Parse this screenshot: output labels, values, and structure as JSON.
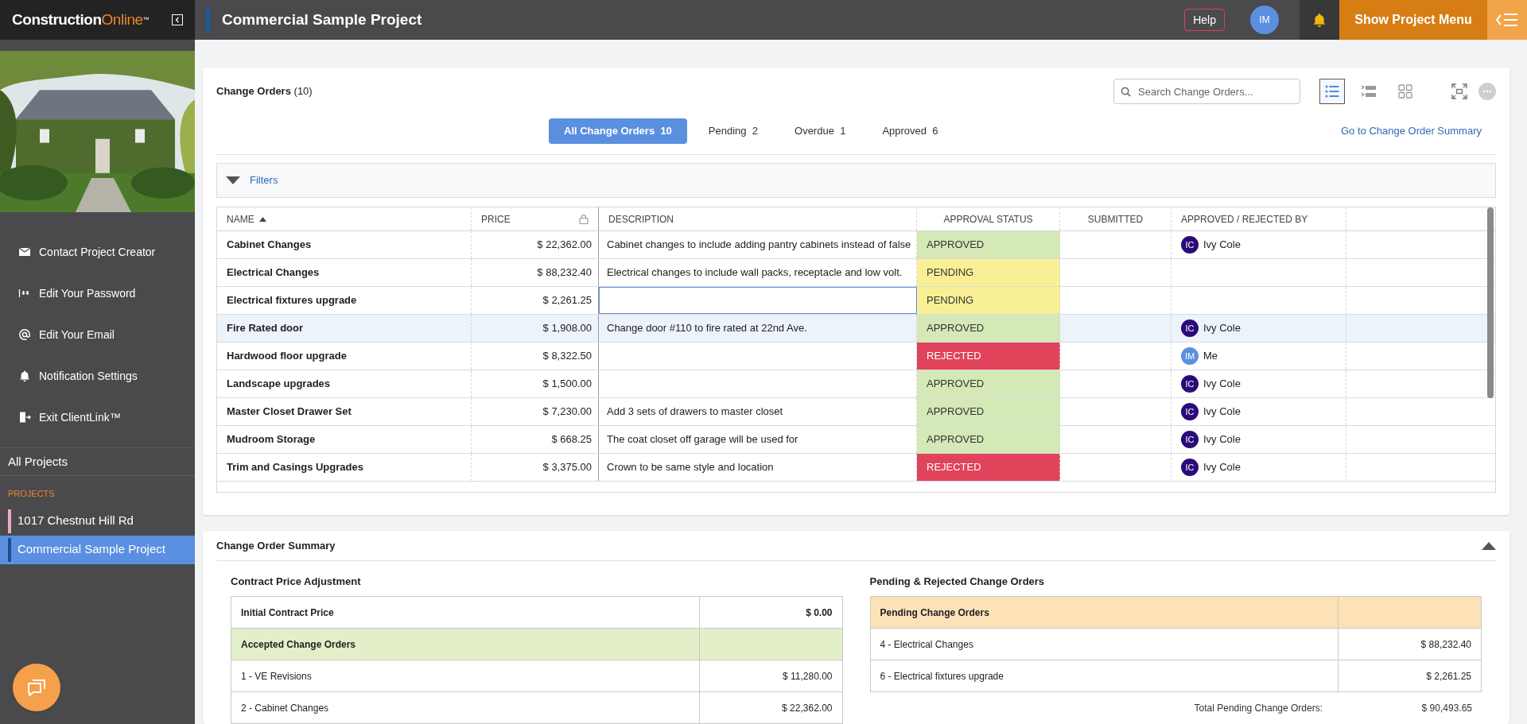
{
  "brand": {
    "name": "Construction",
    "accent": "Online",
    "mark": "™"
  },
  "header": {
    "project_title": "Commercial Sample Project",
    "help": "Help",
    "user_initials": "IM",
    "menu_button": "Show Project Menu"
  },
  "sidebar": {
    "items": [
      {
        "kind": "mail",
        "label": "Contact Project Creator"
      },
      {
        "kind": "password",
        "label": "Edit Your Password"
      },
      {
        "kind": "at",
        "label": "Edit Your Email"
      },
      {
        "kind": "bell",
        "label": "Notification Settings"
      },
      {
        "kind": "exit",
        "label": "Exit ClientLink™"
      }
    ],
    "all_projects": "All Projects",
    "projects_heading": "PROJECTS",
    "projects": [
      {
        "name": "1017 Chestnut Hill Rd",
        "color": "#f4a7c8",
        "selected": false
      },
      {
        "name": "Commercial Sample Project",
        "color": "#1d4f8c",
        "selected": true
      }
    ]
  },
  "change_orders": {
    "title": "Change Orders",
    "count": "(10)",
    "search": {
      "placeholder": "Search Change Orders..."
    },
    "view_modes": [
      {
        "kind": "list",
        "selected": true
      },
      {
        "kind": "detail",
        "selected": false
      },
      {
        "kind": "grid",
        "selected": false
      }
    ],
    "tabs": [
      {
        "label": "All Change Orders",
        "count": "10",
        "selected": true
      },
      {
        "label": "Pending",
        "count": "2",
        "selected": false
      },
      {
        "label": "Overdue",
        "count": "1",
        "selected": false
      },
      {
        "label": "Approved",
        "count": "6",
        "selected": false
      }
    ],
    "summary_link": "Go to Change Order Summary",
    "filters": "Filters",
    "table": {
      "columns": [
        "NAME",
        "PRICE",
        "DESCRIPTION",
        "APPROVAL STATUS",
        "SUBMITTED",
        "APPROVED / REJECTED BY"
      ],
      "rows": [
        {
          "name": "Cabinet Changes",
          "price": "$ 22,362.00",
          "description": "Cabinet changes to include adding pantry cabinets instead of false",
          "status": {
            "kind": "approved",
            "label": "APPROVED"
          },
          "approver": {
            "initials": "IC",
            "name": "Ivy Cole",
            "color": "#2b0a78"
          },
          "hovered": false,
          "focused": false
        },
        {
          "name": "Electrical Changes",
          "price": "$ 88,232.40",
          "description": "Electrical changes to include wall packs, receptacle and low volt.",
          "status": {
            "kind": "pending",
            "label": "PENDING"
          },
          "hovered": false,
          "focused": false
        },
        {
          "name": "Electrical fixtures upgrade",
          "price": "$ 2,261.25",
          "status": {
            "kind": "pending",
            "label": "PENDING"
          },
          "hovered": false,
          "focused": true
        },
        {
          "name": "Fire Rated door",
          "price": "$ 1,908.00",
          "description": "Change door #110 to fire rated at 22nd Ave.",
          "status": {
            "kind": "approved",
            "label": "APPROVED"
          },
          "approver": {
            "initials": "IC",
            "name": "Ivy Cole",
            "color": "#2b0a78"
          },
          "hovered": true,
          "focused": false
        },
        {
          "name": "Hardwood floor upgrade",
          "price": "$ 8,322.50",
          "status": {
            "kind": "rejected",
            "label": "REJECTED"
          },
          "approver": {
            "initials": "IM",
            "name": "Me",
            "color": "#5b8fe0"
          },
          "hovered": false,
          "focused": false
        },
        {
          "name": "Landscape upgrades",
          "price": "$ 1,500.00",
          "status": {
            "kind": "approved",
            "label": "APPROVED"
          },
          "approver": {
            "initials": "IC",
            "name": "Ivy Cole",
            "color": "#2b0a78"
          },
          "hovered": false,
          "focused": false
        },
        {
          "name": "Master Closet Drawer Set",
          "price": "$ 7,230.00",
          "description": "Add 3 sets of drawers to master closet",
          "status": {
            "kind": "approved",
            "label": "APPROVED"
          },
          "approver": {
            "initials": "IC",
            "name": "Ivy Cole",
            "color": "#2b0a78"
          },
          "hovered": false,
          "focused": false
        },
        {
          "name": "Mudroom Storage",
          "price": "$ 668.25",
          "description": "The coat closet off garage will be used for",
          "status": {
            "kind": "approved",
            "label": "APPROVED"
          },
          "approver": {
            "initials": "IC",
            "name": "Ivy Cole",
            "color": "#2b0a78"
          },
          "hovered": false,
          "focused": false
        },
        {
          "name": "Trim and Casings Upgrades",
          "price": "$ 3,375.00",
          "description": "Crown to be same style and location",
          "status": {
            "kind": "rejected",
            "label": "REJECTED"
          },
          "approver": {
            "initials": "IC",
            "name": "Ivy Cole",
            "color": "#2b0a78"
          },
          "hovered": false,
          "focused": false
        }
      ]
    }
  },
  "summary": {
    "title": "Change Order Summary",
    "left": {
      "title": "Contract Price Adjustment",
      "rows": [
        {
          "kind": "total",
          "label": "Initial Contract Price",
          "amount": "$ 0.00"
        },
        {
          "kind": "group",
          "label": "Accepted Change Orders"
        },
        {
          "kind": "item",
          "label": "1 - VE Revisions",
          "amount": "$ 11,280.00"
        },
        {
          "kind": "item",
          "label": "2 - Cabinet Changes",
          "amount": "$ 22,362.00"
        }
      ]
    },
    "right": {
      "title": "Pending & Rejected Change Orders",
      "rows": [
        {
          "kind": "group",
          "label": "Pending Change Orders"
        },
        {
          "kind": "item",
          "label": "4 - Electrical Changes",
          "amount": "$ 88,232.40"
        },
        {
          "kind": "item",
          "label": "6 - Electrical fixtures upgrade",
          "amount": "$ 2,261.25"
        },
        {
          "kind": "footer",
          "label": "Total Pending Change Orders:",
          "amount": "$ 90,493.65"
        }
      ]
    }
  }
}
